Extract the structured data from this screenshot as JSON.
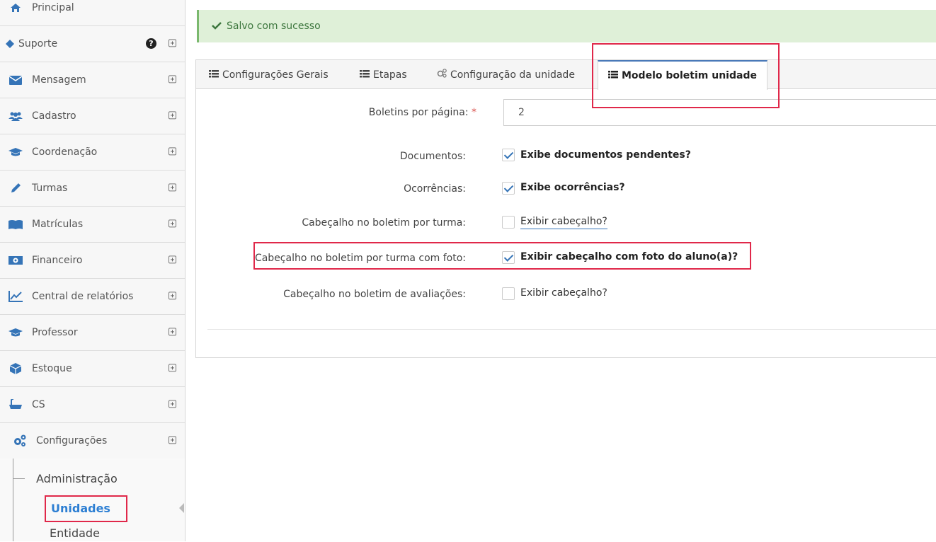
{
  "sidebar": {
    "items": [
      {
        "label": "Principal",
        "icon": "home-icon"
      },
      {
        "label": "Suporte",
        "icon": "diamond-icon"
      },
      {
        "label": "Mensagem",
        "icon": "envelope-icon"
      },
      {
        "label": "Cadastro",
        "icon": "users-icon"
      },
      {
        "label": "Coordenação",
        "icon": "graduation-cap-icon"
      },
      {
        "label": "Turmas",
        "icon": "pencil-icon"
      },
      {
        "label": "Matrículas",
        "icon": "book-icon"
      },
      {
        "label": "Financeiro",
        "icon": "money-icon"
      },
      {
        "label": "Central de relatórios",
        "icon": "chart-icon"
      },
      {
        "label": "Professor",
        "icon": "graduation-cap-icon"
      },
      {
        "label": "Estoque",
        "icon": "cube-icon"
      },
      {
        "label": "CS",
        "icon": "bath-icon"
      },
      {
        "label": "Configurações",
        "icon": "gears-icon"
      }
    ],
    "sub": {
      "administracao": "Administração",
      "unidades": "Unidades",
      "entidade": "Entidade"
    },
    "accent": "#3574b7"
  },
  "alert": {
    "message": "Salvo com sucesso"
  },
  "tabs": [
    {
      "label": "Configurações Gerais"
    },
    {
      "label": "Etapas"
    },
    {
      "label": "Configuração da unidade"
    },
    {
      "label": "Modelo boletim unidade"
    }
  ],
  "form": {
    "boletins_label": "Boletins por página:",
    "boletins_required": "*",
    "boletins_value": "2",
    "documentos_label": "Documentos:",
    "documentos_text": "Exibe documentos pendentes?",
    "ocorrencias_label": "Ocorrências:",
    "ocorrencias_text": "Exibe ocorrências?",
    "cab_turma_label": "Cabeçalho no boletim por turma:",
    "cab_turma_text": "Exibir cabeçalho?",
    "cab_foto_label": "Cabeçalho no boletim por turma com foto:",
    "cab_foto_text": "Exibir cabeçalho com foto do aluno(a)?",
    "cab_aval_label": "Cabeçalho no boletim de avaliações:",
    "cab_aval_text": "Exibir cabeçalho?"
  }
}
